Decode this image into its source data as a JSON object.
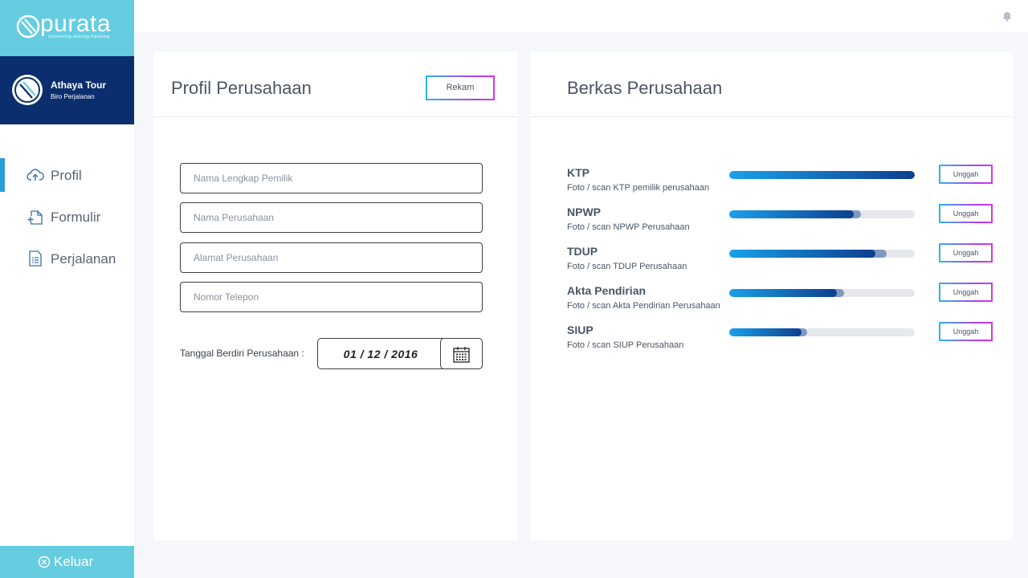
{
  "brand": {
    "name": "purata",
    "tagline": "connecting·sharing·traveling"
  },
  "account": {
    "name": "Athaya Tour",
    "subtitle": "Biro Perjalanan"
  },
  "nav": [
    {
      "label": "Profil",
      "icon": "cloud-upload-icon",
      "active": true
    },
    {
      "label": "Formulir",
      "icon": "file-add-icon",
      "active": false
    },
    {
      "label": "Perjalanan",
      "icon": "document-list-icon",
      "active": false
    }
  ],
  "logout": {
    "label": "Keluar",
    "icon": "close-circle-icon"
  },
  "topbar": {
    "icon": "bell-icon"
  },
  "profile": {
    "title": "Profil Perusahaan",
    "record_label": "Rekam",
    "fields": [
      {
        "placeholder": "Nama Lengkap Pemilik",
        "value": ""
      },
      {
        "placeholder": "Nama Perusahaan",
        "value": ""
      },
      {
        "placeholder": "Alamat Perusahaan",
        "value": ""
      },
      {
        "placeholder": "Nomor Telepon",
        "value": ""
      }
    ],
    "date_label": "Tanggal Berdiri Perusahaan :",
    "date_value": "01 / 12 / 2016",
    "date_icon": "calendar-icon"
  },
  "files": {
    "title": "Berkas Perusahaan",
    "upload_label": "Unggah",
    "items": [
      {
        "name": "KTP",
        "desc": "Foto / scan KTP pemilik perusahaan",
        "progress": 1.0,
        "buffer": 1.0
      },
      {
        "name": "NPWP",
        "desc": "Foto / scan NPWP Perusahaan",
        "progress": 0.67,
        "buffer": 0.71
      },
      {
        "name": "TDUP",
        "desc": "Foto / scan TDUP Perusahaan",
        "progress": 0.79,
        "buffer": 0.85
      },
      {
        "name": "Akta Pendirian",
        "desc": "Foto / scan Akta Pendirian Perusahaan",
        "progress": 0.58,
        "buffer": 0.62
      },
      {
        "name": "SIUP",
        "desc": "Foto / scan SIUP Perusahaan",
        "progress": 0.39,
        "buffer": 0.42
      }
    ]
  },
  "colors": {
    "brand": "#66cde1",
    "account_bg": "#0a2e6e",
    "active_indicator": "#2d9cdb",
    "progress_start": "#1aa0ea",
    "progress_end": "#0d3f8f"
  }
}
